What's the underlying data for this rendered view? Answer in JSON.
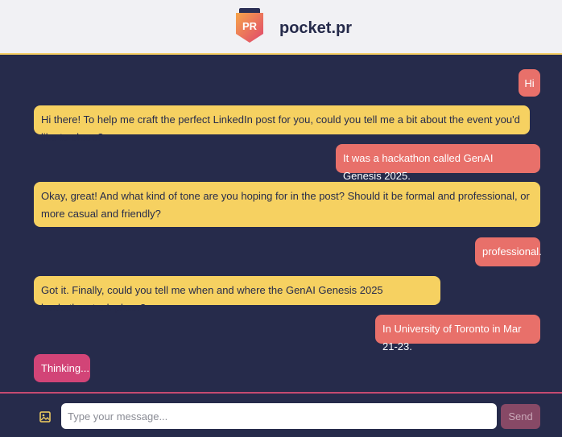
{
  "app": {
    "name": "pocket.pr",
    "logo_text": "PR"
  },
  "colors": {
    "background": "#262b4b",
    "header": "#f1f1f4",
    "bot_bubble": "#f6d161",
    "user_bubble": "#e8706a",
    "thinking_bubble": "#d24477",
    "accent_border": "#f6cf63"
  },
  "messages": [
    {
      "role": "user",
      "text": "Hi"
    },
    {
      "role": "bot",
      "text": "Hi there! To help me craft the perfect LinkedIn post for you, could you tell me a bit about the event you'd like to share?"
    },
    {
      "role": "user",
      "text": "It was a hackathon called GenAI Genesis 2025."
    },
    {
      "role": "bot",
      "text": "Okay, great! And what kind of tone are you hoping for in the post? Should it be formal and professional, or more casual and friendly?"
    },
    {
      "role": "user",
      "text": "professional."
    },
    {
      "role": "bot",
      "text": "Got it. Finally, could you tell me when and where the GenAI Genesis 2025 hackathon took place?"
    },
    {
      "role": "user",
      "text": "In University of Toronto in Mar 21-23."
    }
  ],
  "status": {
    "thinking": "Thinking..."
  },
  "composer": {
    "placeholder": "Type your message...",
    "value": "",
    "send_label": "Send",
    "attach_icon": "image-icon"
  }
}
